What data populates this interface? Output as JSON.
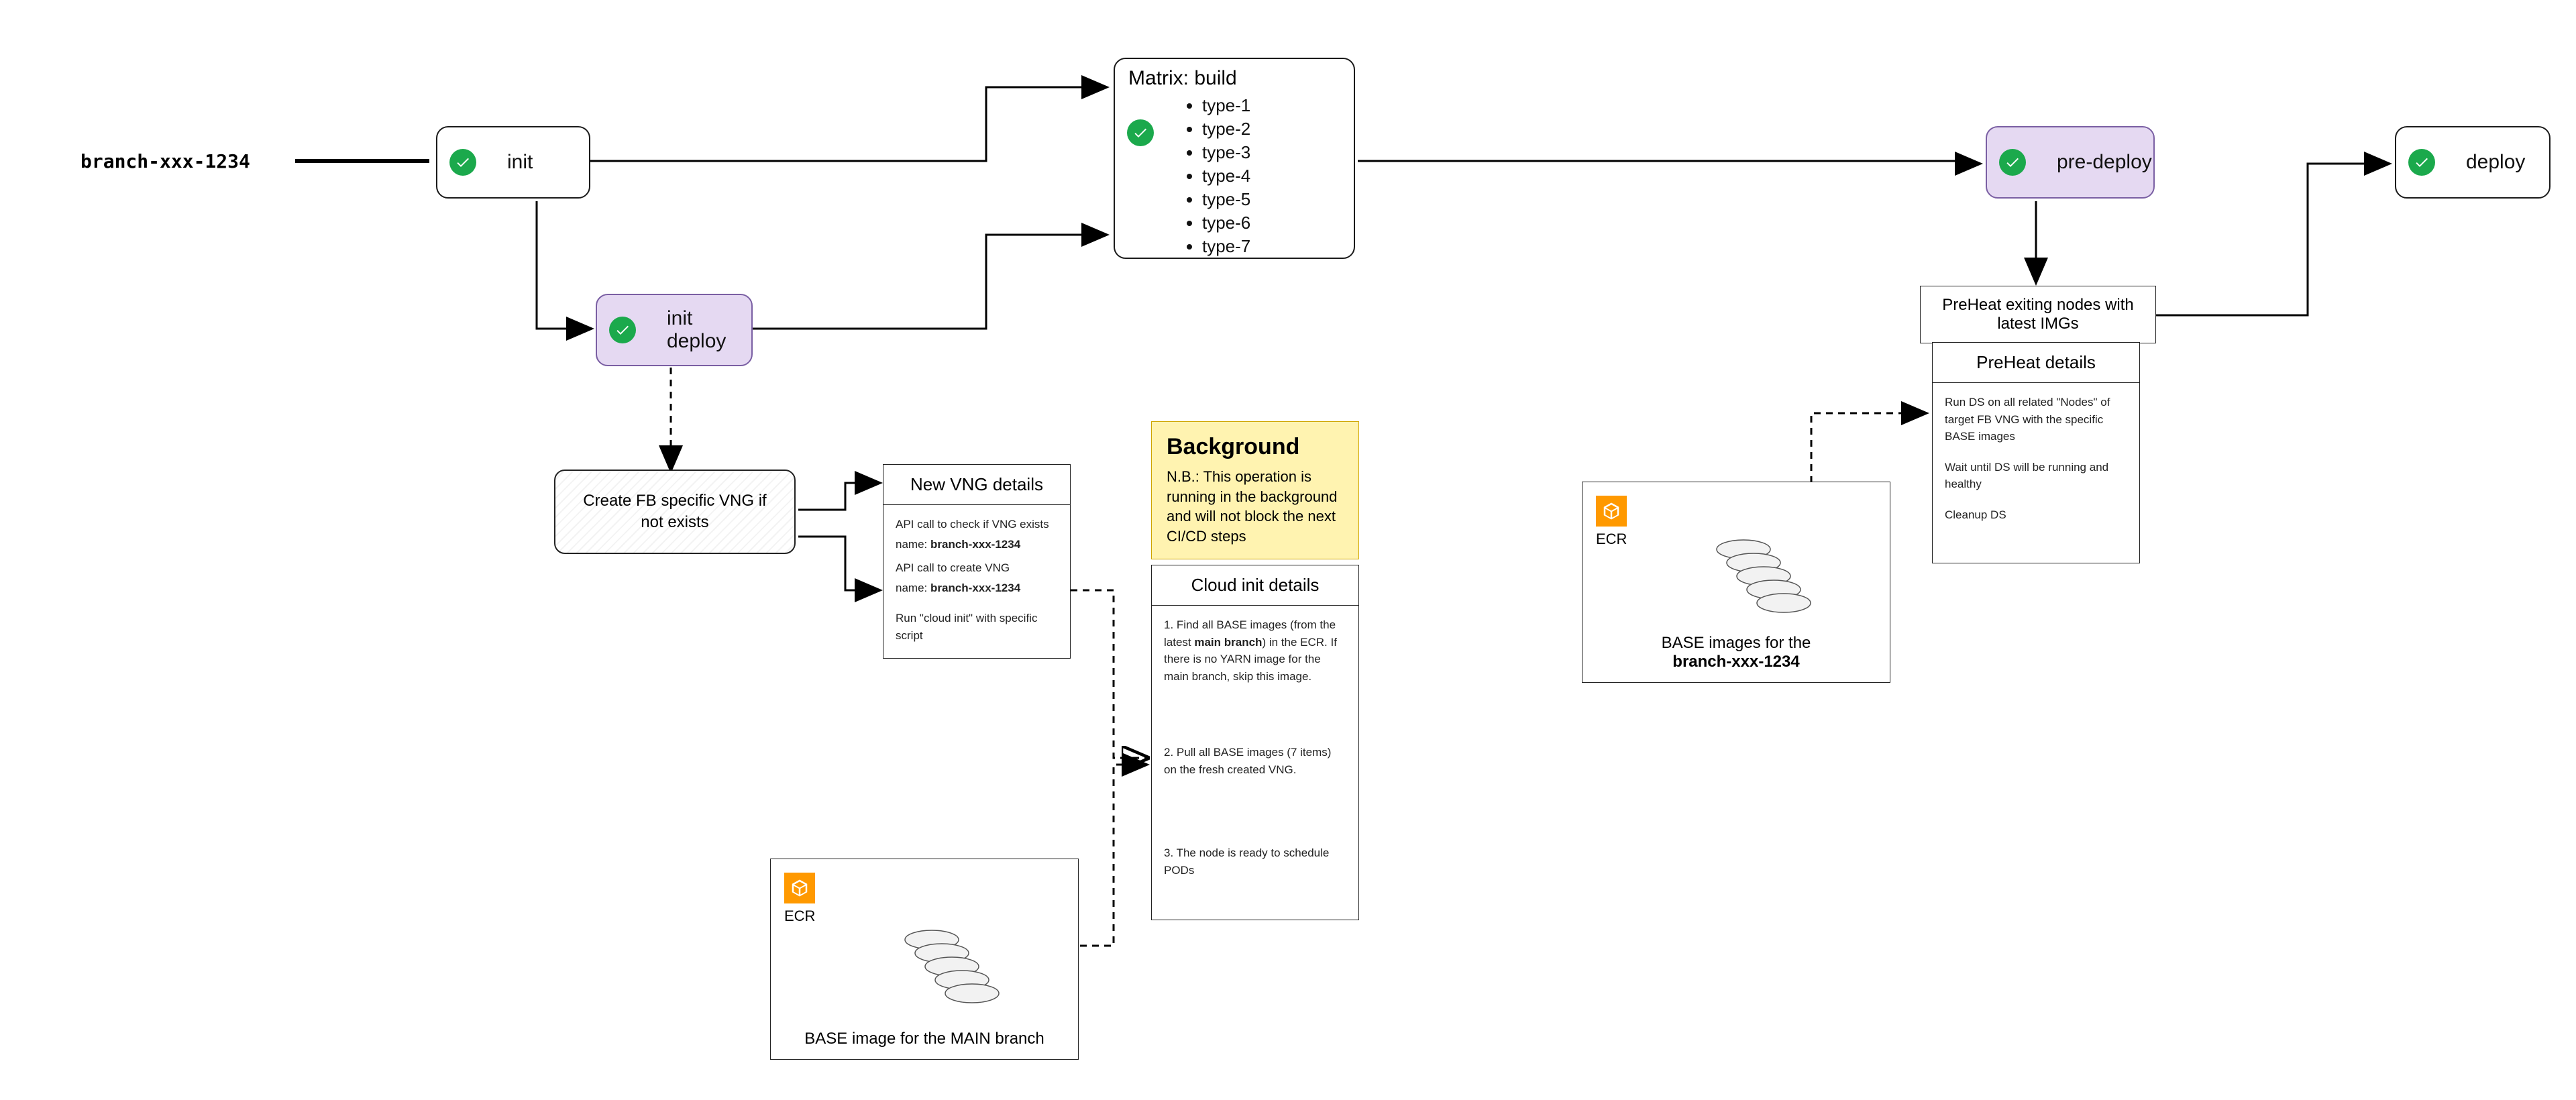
{
  "branch_name": "branch-xxx-1234",
  "nodes": {
    "init": "init",
    "init_deploy": "init deploy",
    "pre_deploy": "pre-deploy",
    "deploy": "deploy"
  },
  "matrix": {
    "title": "Matrix: build",
    "items": [
      "type-1",
      "type-2",
      "type-3",
      "type-4",
      "type-5",
      "type-6",
      "type-7"
    ]
  },
  "hatch_vng": "Create FB specific VNG if not exists",
  "vng_panel": {
    "title": "New VNG details",
    "l1": "API call to check if VNG exists",
    "l2_pre": "name: ",
    "l2_b": "branch-xxx-1234",
    "l3": "API call to create VNG",
    "l4_pre": "name: ",
    "l4_b": "branch-xxx-1234",
    "l5": "Run \"cloud init\" with specific script"
  },
  "note": {
    "title": "Background",
    "body": "N.B.: This operation is running in the background and will not block the next CI/CD steps"
  },
  "cloud_panel": {
    "title": "Cloud init details",
    "s1a": "1. Find all BASE images (from the latest ",
    "s1b": "main branch",
    "s1c": ") in the ECR. If there is no YARN image for the main branch, skip this image.",
    "s2": "2. Pull all BASE images (7 items) on the fresh created VNG.",
    "s3": "3. The node is ready to schedule PODs"
  },
  "preheat_box": "PreHeat exiting nodes with latest IMGs",
  "preheat_panel": {
    "title": "PreHeat details",
    "p1": "Run DS on all related \"Nodes\" of target FB VNG with the specific BASE images",
    "p2": "Wait until DS will be running and healthy",
    "p3": "Cleanup DS"
  },
  "ecr1": {
    "label": "ECR",
    "caption": "BASE image for the MAIN branch"
  },
  "ecr2": {
    "label": "ECR",
    "caption_pre": "BASE images for the",
    "caption_b": "branch-xxx-1234"
  }
}
